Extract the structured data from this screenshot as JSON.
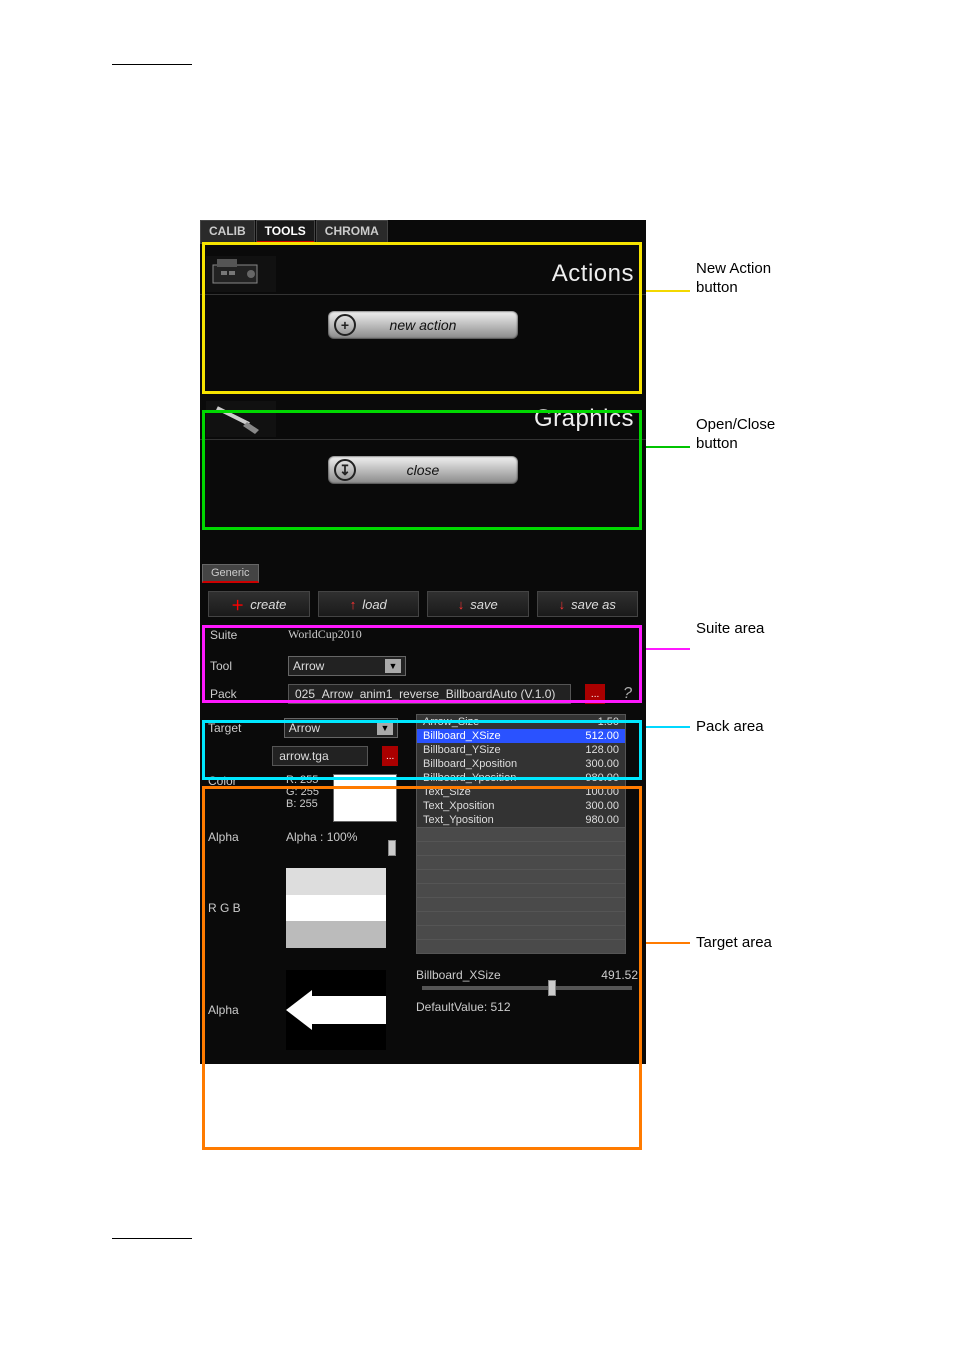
{
  "tabs": {
    "calib": "CALIB",
    "tools": "TOOLS",
    "chroma": "CHROMA"
  },
  "sections": {
    "actions": {
      "title": "Actions",
      "button": "new action"
    },
    "graphics": {
      "title": "Graphics",
      "button": "close"
    }
  },
  "subtab": {
    "generic": "Generic"
  },
  "suite": {
    "create": "create",
    "load": "load",
    "save": "save",
    "save_as": "save as",
    "label": "Suite",
    "value": "WorldCup2010"
  },
  "tool": {
    "label": "Tool",
    "value": "Arrow"
  },
  "pack": {
    "label": "Pack",
    "value": "025_Arrow_anim1_reverse_BillboardAuto (V.1.0)",
    "ellipsis": "..."
  },
  "target": {
    "label": "Target",
    "select": "Arrow",
    "file": "arrow.tga",
    "file_btn": "...",
    "color_label": "Color",
    "r": "R: 255",
    "g": "G: 255",
    "b": "B: 255",
    "alpha_label": "Alpha",
    "alpha_val": "Alpha : 100%",
    "rgb_label": "R G B",
    "alpha2_label": "Alpha"
  },
  "props": [
    {
      "name": "Arrow_Size",
      "val": "1.50"
    },
    {
      "name": "Billboard_XSize",
      "val": "512.00",
      "sel": true
    },
    {
      "name": "Billboard_YSize",
      "val": "128.00"
    },
    {
      "name": "Billboard_Xposition",
      "val": "300.00"
    },
    {
      "name": "Billboard_Yposition",
      "val": "980.00"
    },
    {
      "name": "Text_Size",
      "val": "100.00"
    },
    {
      "name": "Text_Xposition",
      "val": "300.00"
    },
    {
      "name": "Text_Yposition",
      "val": "980.00"
    }
  ],
  "slider": {
    "name": "Billboard_XSize",
    "val": "491.52",
    "default": "DefaultValue: 512"
  },
  "callouts": {
    "new_action": "New Action button",
    "open_close": "Open/Close button",
    "suite": "Suite area",
    "pack": "Pack area",
    "target": "Target area"
  }
}
